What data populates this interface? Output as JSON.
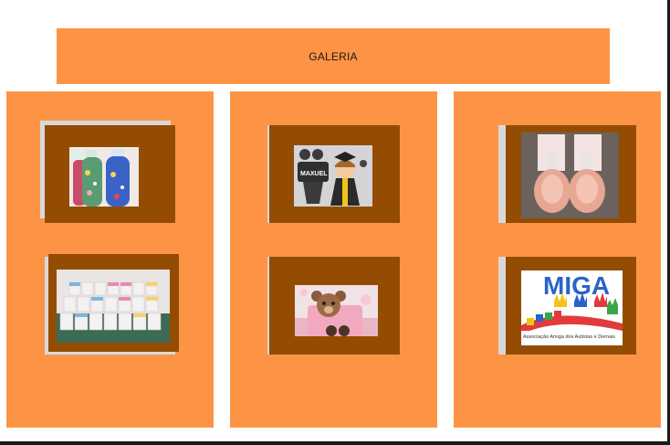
{
  "header": {
    "title": "GALERIA"
  },
  "gallery": {
    "columns": [
      {
        "items": [
          {
            "icon": "sensory-bottles-photo",
            "caption": ""
          },
          {
            "icon": "calendar-favors-photo",
            "caption": ""
          }
        ]
      },
      {
        "items": [
          {
            "icon": "graduation-cutout-photo",
            "text": "MAXUEL"
          },
          {
            "icon": "teddy-bear-cake-photo",
            "caption": ""
          }
        ]
      },
      {
        "items": [
          {
            "icon": "perfume-bottles-photo",
            "caption": ""
          },
          {
            "icon": "amigas-logo-photo",
            "logo_text": "MIGA",
            "subtitle": "Associação Amiga dos Autistas e Demais"
          }
        ]
      }
    ]
  },
  "colors": {
    "background": "#ffffff",
    "header_bg": "#fd9445",
    "column_bg": "#fd9445",
    "card_frame": "#944c02",
    "card_shadow": "#d9d9d9"
  }
}
